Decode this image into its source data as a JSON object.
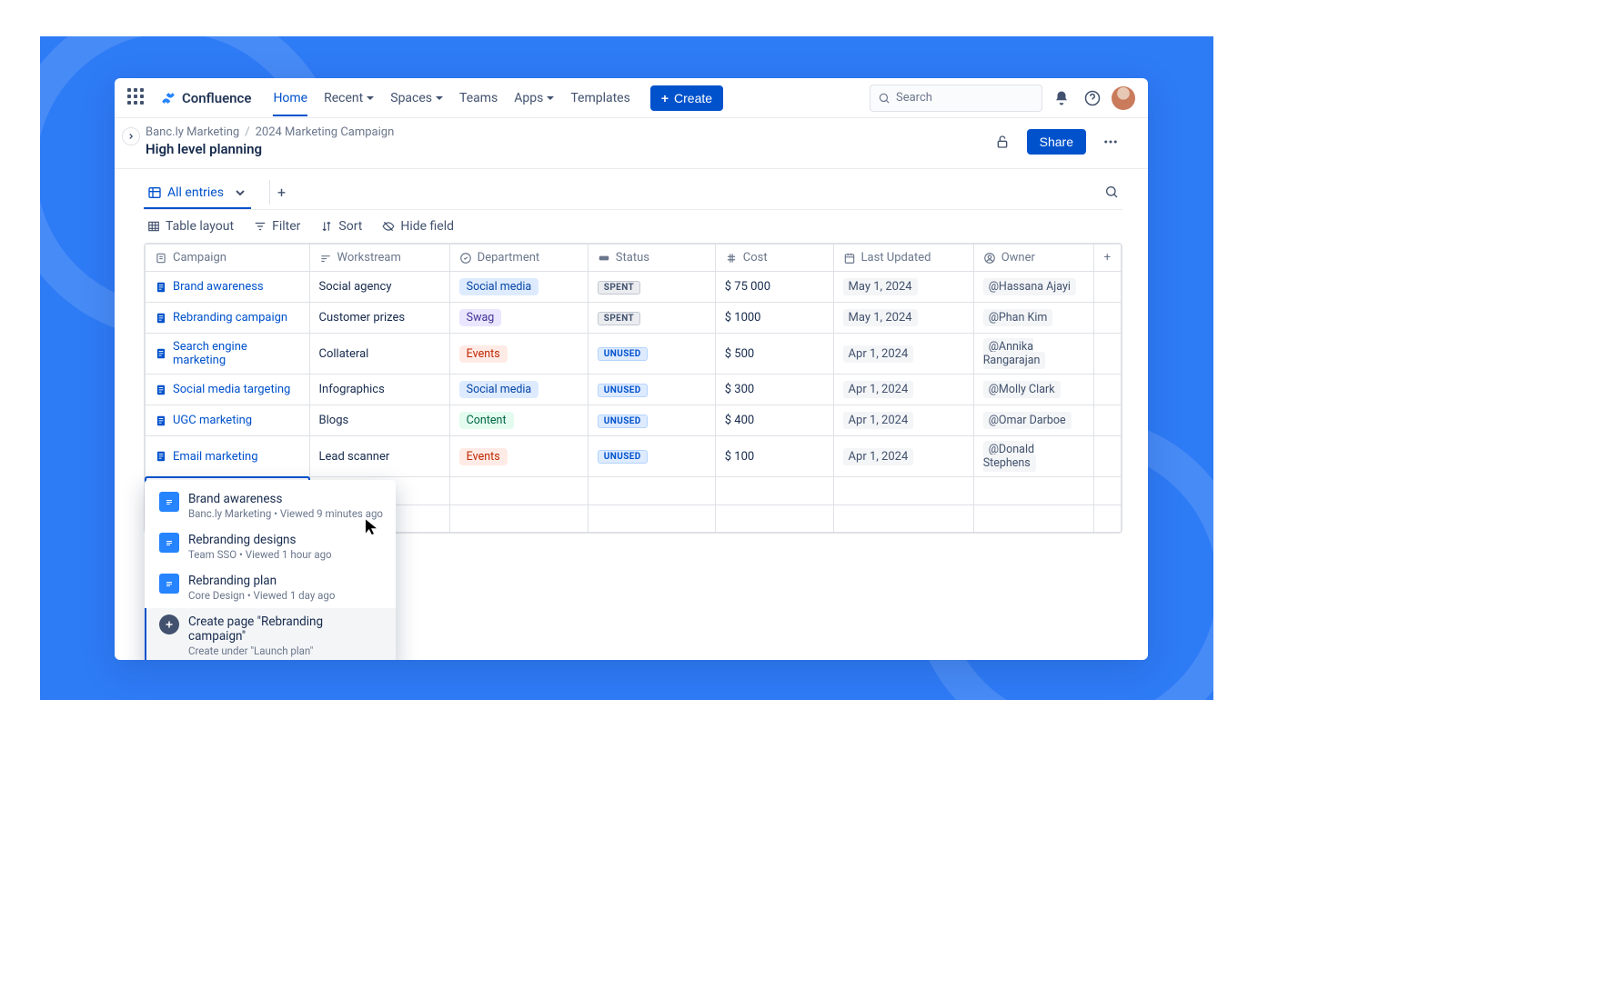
{
  "brand": "Confluence",
  "nav": {
    "home": "Home",
    "recent": "Recent",
    "spaces": "Spaces",
    "teams": "Teams",
    "apps": "Apps",
    "templates": "Templates",
    "create": "Create"
  },
  "search_placeholder": "Search",
  "breadcrumb": {
    "space": "Banc.ly Marketing",
    "parent": "2024 Marketing Campaign"
  },
  "page_title": "High level planning",
  "share": "Share",
  "view_tab": "All entries",
  "toolbar": {
    "layout": "Table layout",
    "filter": "Filter",
    "sort": "Sort",
    "hide": "Hide field"
  },
  "columns": {
    "campaign": "Campaign",
    "workstream": "Workstream",
    "department": "Department",
    "status": "Status",
    "cost": "Cost",
    "updated": "Last Updated",
    "owner": "Owner"
  },
  "rows": [
    {
      "campaign": "Brand awareness",
      "work": "Social agency",
      "dept": "Social media",
      "dept_cls": "sm",
      "status": "SPENT",
      "status_cls": "spent",
      "cost": "$ 75 000",
      "date": "May 1, 2024",
      "owner": "@Hassana Ajayi"
    },
    {
      "campaign": "Rebranding campaign",
      "work": "Customer prizes",
      "dept": "Swag",
      "dept_cls": "swag",
      "status": "SPENT",
      "status_cls": "spent",
      "cost": "$ 1000",
      "date": "May 1, 2024",
      "owner": "@Phan Kim"
    },
    {
      "campaign": "Search engine marketing",
      "work": "Collateral",
      "dept": "Events",
      "dept_cls": "events",
      "status": "UNUSED",
      "status_cls": "unused",
      "cost": "$ 500",
      "date": "Apr 1, 2024",
      "owner": "@Annika Rangarajan"
    },
    {
      "campaign": "Social media targeting",
      "work": "Infographics",
      "dept": "Social media",
      "dept_cls": "sm",
      "status": "UNUSED",
      "status_cls": "unused",
      "cost": "$ 300",
      "date": "Apr 1, 2024",
      "owner": "@Molly Clark"
    },
    {
      "campaign": "UGC marketing",
      "work": "Blogs",
      "dept": "Content",
      "dept_cls": "content",
      "status": "UNUSED",
      "status_cls": "unused",
      "cost": "$ 400",
      "date": "Apr 1, 2024",
      "owner": "@Omar Darboe"
    },
    {
      "campaign": "Email marketing",
      "work": "Lead scanner",
      "dept": "Events",
      "dept_cls": "events",
      "status": "UNUSED",
      "status_cls": "unused",
      "cost": "$ 100",
      "date": "Apr 1, 2024",
      "owner": "@Donald Stephens"
    }
  ],
  "new_row_value": "Rebranding campaign",
  "dropdown": [
    {
      "title": "Brand awareness",
      "sub": "Banc.ly Marketing   •   Viewed 9 minutes ago",
      "icon": "page"
    },
    {
      "title": "Rebranding designs",
      "sub": "Team SSO   •   Viewed 1 hour ago",
      "icon": "page"
    },
    {
      "title": "Rebranding plan",
      "sub": "Core Design   •   Viewed 1 day ago",
      "icon": "page"
    },
    {
      "title": "Create page \"Rebranding campaign\"",
      "sub": "Create under \"Launch plan\"",
      "icon": "plus",
      "hover": true
    }
  ]
}
